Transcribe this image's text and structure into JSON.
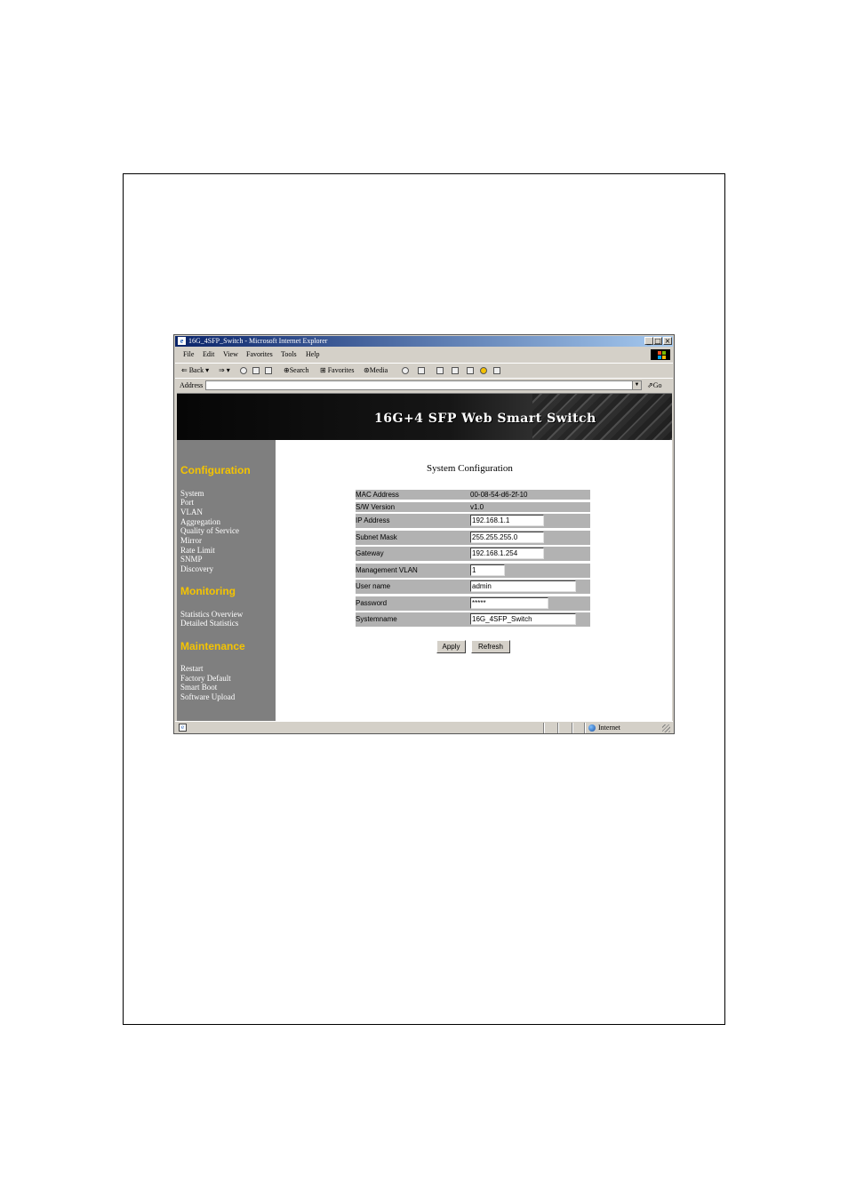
{
  "browser": {
    "title": "16G_4SFP_Switch - Microsoft Internet Explorer",
    "menu": [
      "File",
      "Edit",
      "View",
      "Favorites",
      "Tools",
      "Help"
    ],
    "toolbar": {
      "back": "Back",
      "search": "Search",
      "favorites": "Favorites",
      "media": "Media"
    },
    "address_label": "Address",
    "go_label": "Go",
    "status_zone": "Internet"
  },
  "banner": {
    "title": "16G+4 SFP Web Smart Switch"
  },
  "sidebar": {
    "configuration": {
      "heading": "Configuration",
      "items": [
        "System",
        "Port",
        "VLAN",
        "Aggregation",
        "Quality of Service",
        "Mirror",
        "Rate Limit",
        "SNMP",
        "Discovery"
      ]
    },
    "monitoring": {
      "heading": "Monitoring",
      "items": [
        "Statistics Overview",
        "Detailed Statistics"
      ]
    },
    "maintenance": {
      "heading": "Maintenance",
      "items": [
        "Restart",
        "Factory Default",
        "Smart Boot",
        "Software Upload"
      ]
    }
  },
  "main": {
    "title": "System Configuration",
    "rows": [
      {
        "label": "MAC Address",
        "value": "00-08-54-d6-2f-10"
      },
      {
        "label": "S/W Version",
        "value": "v1.0"
      },
      {
        "label": "IP Address",
        "value": "192.168.1.1"
      },
      {
        "label": "Subnet Mask",
        "value": "255.255.255.0"
      },
      {
        "label": "Gateway",
        "value": "192.168.1.254"
      },
      {
        "label": "Management VLAN",
        "value": "1"
      },
      {
        "label": "User name",
        "value": "admin"
      },
      {
        "label": "Password",
        "value": "*****"
      },
      {
        "label": "Systemname",
        "value": "16G_4SFP_Switch"
      }
    ],
    "apply_label": "Apply",
    "refresh_label": "Refresh"
  }
}
